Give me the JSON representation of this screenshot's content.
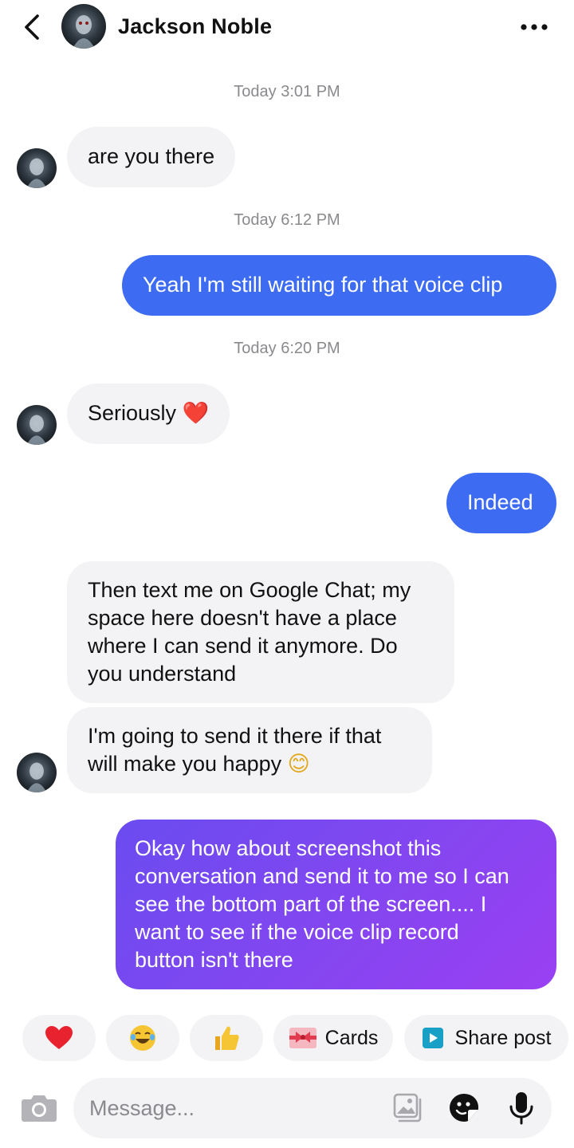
{
  "header": {
    "contact_name": "Jackson Noble"
  },
  "conversation": {
    "timestamps": [
      "Today 3:01 PM",
      "Today 6:12 PM",
      "Today 6:20 PM"
    ],
    "messages": [
      {
        "direction": "in",
        "text": "are you there"
      },
      {
        "direction": "out",
        "text": "Yeah I'm still waiting for that voice clip"
      },
      {
        "direction": "in",
        "text": "Seriously",
        "emoji": "❤️"
      },
      {
        "direction": "out",
        "text": "Indeed"
      },
      {
        "direction": "in",
        "lines": [
          "Then text me on Google Chat; my",
          "space here doesn't have a place",
          "where I can send it anymore. Do",
          "you understand"
        ]
      },
      {
        "direction": "in",
        "lines": [
          "I'm going to send it there if that",
          "will make you happy"
        ],
        "emoji": "😊"
      },
      {
        "direction": "out",
        "lines": [
          "Okay how about screenshot this",
          "conversation and send it to me so I can",
          "see the bottom part of the screen.... I",
          "want to see if the voice clip record",
          "button isn't there"
        ]
      }
    ]
  },
  "quick_actions": [
    {
      "emoji": "❤️",
      "icon": "heart-icon"
    },
    {
      "emoji": "😂",
      "icon": "laughing-emoji-icon"
    },
    {
      "emoji": "👍",
      "icon": "thumbs-up-icon"
    },
    {
      "label": "Cards",
      "icon": "cards-icon"
    },
    {
      "label": "Share post",
      "icon": "share-post-icon"
    }
  ],
  "composer": {
    "placeholder": "Message..."
  },
  "colors": {
    "outgoing_bubble": "#3d6cf2",
    "outgoing_gradient_start": "#6a4cf0",
    "outgoing_gradient_end": "#9a3ff3",
    "incoming_bubble": "#f3f3f5",
    "timestamp_text": "#8a8a8e"
  }
}
